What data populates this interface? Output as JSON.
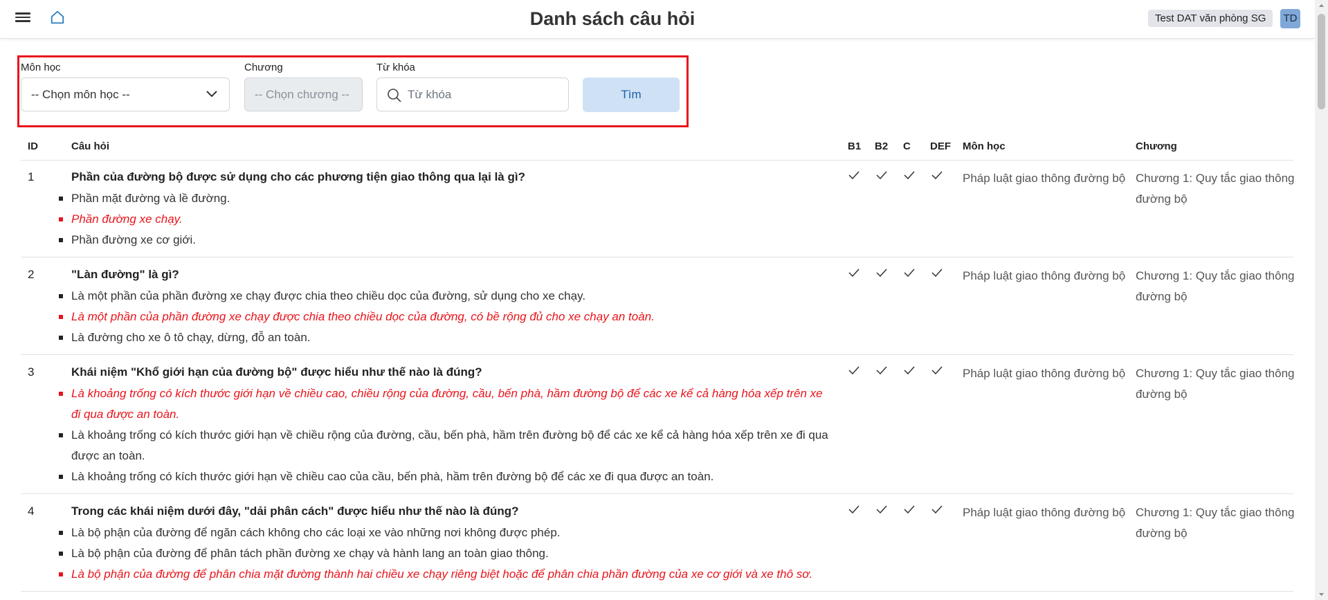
{
  "header": {
    "title": "Danh sách câu hỏi",
    "user_label": "Test DAT văn phòng SG",
    "avatar_initials": "TD"
  },
  "filter": {
    "subject_label": "Môn học",
    "subject_value": "-- Chọn môn học --",
    "chapter_label": "Chương",
    "chapter_placeholder": "-- Chọn chương --",
    "keyword_label": "Từ khóa",
    "keyword_placeholder": "Từ khóa",
    "search_button": "Tìm"
  },
  "table": {
    "columns": {
      "id": "ID",
      "question": "Câu hỏi",
      "b1": "B1",
      "b2": "B2",
      "c": "C",
      "def": "DEF",
      "subject": "Môn học",
      "chapter": "Chương"
    },
    "rows": [
      {
        "id": "1",
        "question": "Phần của đường bộ được sử dụng cho các phương tiện giao thông qua lại là gì?",
        "answers": [
          {
            "text": "Phần mặt đường và lề đường.",
            "correct": false
          },
          {
            "text": "Phần đường xe chạy.",
            "correct": true
          },
          {
            "text": "Phần đường xe cơ giới.",
            "correct": false
          }
        ],
        "subject": "Pháp luật giao thông đường bộ",
        "chapter": "Chương 1: Quy tắc giao thông đường bộ"
      },
      {
        "id": "2",
        "question": "\"Làn đường\" là gì?",
        "answers": [
          {
            "text": "Là một phần của phần đường xe chạy được chia theo chiều dọc của đường, sử dụng cho xe chạy.",
            "correct": false
          },
          {
            "text": "Là một phần của phần đường xe chạy được chia theo chiều dọc của đường, có bề rộng đủ cho xe chạy an toàn.",
            "correct": true
          },
          {
            "text": "Là đường cho xe ô tô chạy, dừng, đỗ an toàn.",
            "correct": false
          }
        ],
        "subject": "Pháp luật giao thông đường bộ",
        "chapter": "Chương 1: Quy tắc giao thông đường bộ"
      },
      {
        "id": "3",
        "question": "Khái niệm \"Khổ giới hạn của đường bộ\" được hiểu như thế nào là đúng?",
        "answers": [
          {
            "text": "Là khoảng trống có kích thước giới hạn về chiều cao, chiều rộng của đường, cầu, bến phà, hầm đường bộ để các xe kể cả hàng hóa xếp trên xe đi qua được an toàn.",
            "correct": true
          },
          {
            "text": "Là khoảng trống có kích thước giới hạn về chiều rộng của đường, cầu, bến phà, hầm trên đường bộ để các xe kể cả hàng hóa xếp trên xe đi qua được an toàn.",
            "correct": false
          },
          {
            "text": "Là khoảng trống có kích thước giới hạn về chiều cao của cầu, bến phà, hầm trên đường bộ để các xe đi qua được an toàn.",
            "correct": false
          }
        ],
        "subject": "Pháp luật giao thông đường bộ",
        "chapter": "Chương 1: Quy tắc giao thông đường bộ"
      },
      {
        "id": "4",
        "question": "Trong các khái niệm dưới đây, \"dải phân cách\" được hiểu như thế nào là đúng?",
        "answers": [
          {
            "text": "Là bộ phận của đường để ngăn cách không cho các loại xe vào những nơi không được phép.",
            "correct": false
          },
          {
            "text": "Là bộ phận của đường để phân tách phần đường xe chạy và hành lang an toàn giao thông.",
            "correct": false
          },
          {
            "text": "Là bộ phận của đường để phân chia mặt đường thành hai chiều xe chạy riêng biệt hoặc để phân chia phần đường của xe cơ giới và xe thô sơ.",
            "correct": true
          }
        ],
        "subject": "Pháp luật giao thông đường bộ",
        "chapter": "Chương 1: Quy tắc giao thông đường bộ"
      }
    ]
  },
  "icons": {
    "menu": "hamburger-menu-icon",
    "home": "home-icon",
    "chevron": "chevron-down-icon",
    "search": "search-icon",
    "check": "check-icon"
  },
  "colors": {
    "correct_answer": "#e8141b",
    "highlight_border": "#e8141b",
    "button_bg": "#cfe2f5",
    "avatar_bg": "#7fa8d8"
  }
}
